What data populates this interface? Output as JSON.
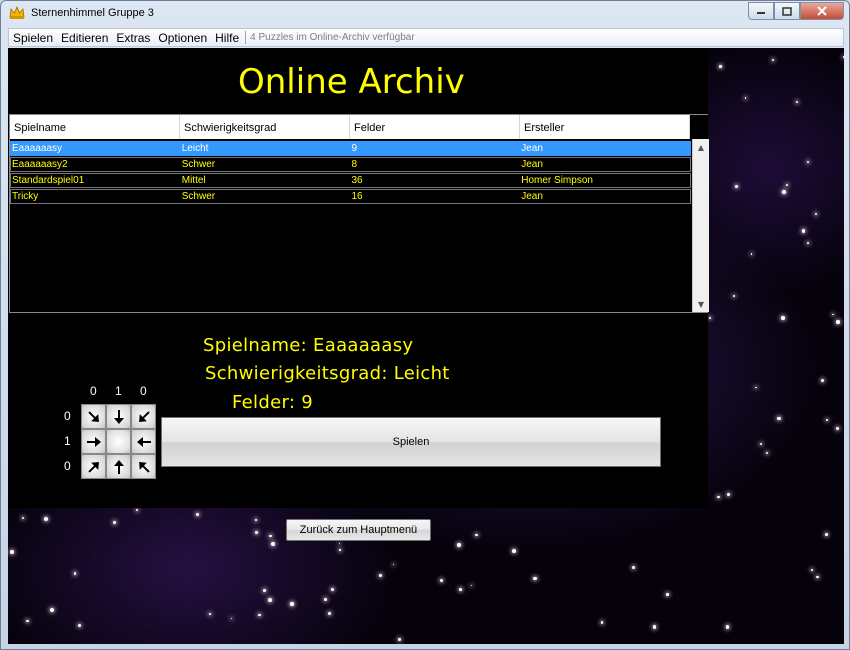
{
  "window": {
    "title": "Sternenhimmel Gruppe 3",
    "controls": [
      "minimize",
      "maximize",
      "close"
    ]
  },
  "menubar": {
    "items": [
      "Spielen",
      "Editieren",
      "Extras",
      "Optionen",
      "Hilfe"
    ],
    "status": "4 Puzzles im Online-Archiv verfügbar"
  },
  "heading": "Online Archiv",
  "table": {
    "columns": [
      "Spielname",
      "Schwierigkeitsgrad",
      "Felder",
      "Ersteller"
    ],
    "rows": [
      [
        "Eaaaaaasy",
        "Leicht",
        "9",
        "Jean"
      ],
      [
        "Eaaaaaasy2",
        "Schwer",
        "8",
        "Jean"
      ],
      [
        "Standardspiel01",
        "Mittel",
        "36",
        "Homer Simpson"
      ],
      [
        "Tricky",
        "Schwer",
        "16",
        "Jean"
      ]
    ],
    "selected_row": 0
  },
  "details": {
    "name_line": "Spielname: Eaaaaaasy",
    "difficulty_line": "Schwierigkeitsgrad: Leicht",
    "fields_line": "Felder: 9"
  },
  "preview": {
    "col_labels": [
      "0",
      "1",
      "0"
    ],
    "row_labels": [
      "0",
      "1",
      "0"
    ],
    "cells": [
      [
        "arrow-down-right-icon",
        "arrow-down-icon",
        "arrow-down-left-icon"
      ],
      [
        "arrow-right-icon",
        "empty",
        "arrow-left-icon"
      ],
      [
        "arrow-up-right-icon",
        "arrow-up-icon",
        "arrow-up-left-icon"
      ]
    ]
  },
  "buttons": {
    "play": "Spielen",
    "back": "Zurück zum Hauptmenü"
  },
  "colors": {
    "text_highlight": "#ffff00",
    "selection": "#3399ff",
    "background": "#000000"
  }
}
